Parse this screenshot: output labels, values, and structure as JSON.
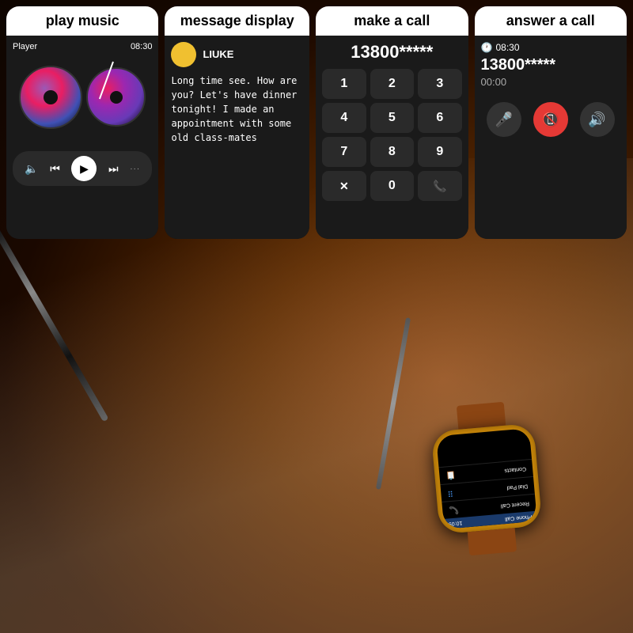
{
  "panels": {
    "music": {
      "label": "play music",
      "header_left": "Player",
      "header_right": "08:30",
      "controls": {
        "volume": "🔈",
        "prev": "⏮",
        "play": "▶",
        "next": "⏭",
        "dots": "···"
      }
    },
    "message": {
      "label": "message display",
      "contact_name": "LIUKE",
      "message_text": "Long time see. How are you? Let's have dinner tonight! I made an appointment with some old class-mates"
    },
    "call": {
      "label": "make a call",
      "number": "13800*****",
      "keys": [
        "1",
        "2",
        "3",
        "4",
        "5",
        "6",
        "7",
        "8",
        "9",
        "✕",
        "0",
        "📞"
      ]
    },
    "answer": {
      "label": "answer a call",
      "time": "08:30",
      "number": "13800*****",
      "duration": "00:00",
      "btn_mic": "🎤",
      "btn_end": "📵",
      "btn_speaker": "🔊"
    }
  },
  "watch": {
    "app_title": "Phone Call",
    "time": "10:09",
    "menu_items": [
      {
        "label": "Recent Call",
        "icon": "📞"
      },
      {
        "label": "Dial Pad",
        "icon": "⠿"
      },
      {
        "label": "Contacts",
        "icon": "📋"
      }
    ]
  }
}
